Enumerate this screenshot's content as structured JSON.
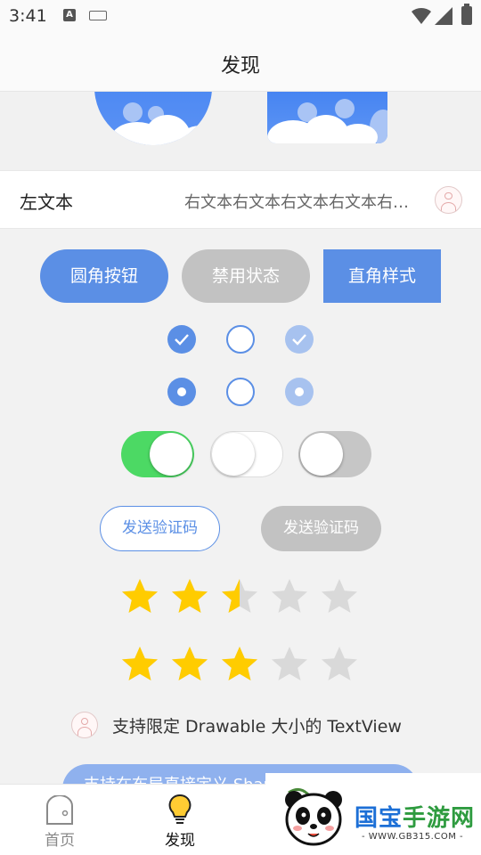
{
  "status_bar": {
    "time": "3:41",
    "notification_icon": "A",
    "icons": [
      "keyboard-icon",
      "wifi-icon",
      "signal-icon",
      "battery-icon"
    ]
  },
  "title_bar": {
    "title": "发现"
  },
  "setting_row": {
    "left_text": "左文本",
    "right_text": "右文本右文本右文本右文本右文本"
  },
  "buttons": {
    "rounded": "圆角按钮",
    "disabled": "禁用状态",
    "square": "直角样式"
  },
  "checkboxes": [
    {
      "state": "checked"
    },
    {
      "state": "unchecked"
    },
    {
      "state": "checked-disabled"
    }
  ],
  "radios": [
    {
      "state": "selected"
    },
    {
      "state": "unselected"
    },
    {
      "state": "selected-disabled"
    }
  ],
  "switches": [
    {
      "state": "on"
    },
    {
      "state": "off"
    },
    {
      "state": "disabled"
    }
  ],
  "verify_buttons": {
    "active": "发送验证码",
    "disabled": "发送验证码"
  },
  "ratings": [
    {
      "value": 2.5,
      "max": 5
    },
    {
      "value": 3,
      "max": 5
    }
  ],
  "drawable_text": "支持限定 Drawable 大小的 TextView",
  "custom_button": "支持在布局直接定义 Shape",
  "bottom_nav": {
    "items": [
      {
        "label": "首页"
      },
      {
        "label": "发现"
      }
    ]
  },
  "watermark": {
    "title_part1": "国宝",
    "title_part2": "手游网",
    "url": "- WWW.GB315.COM -"
  },
  "colors": {
    "accent": "#5b8fe5",
    "switch_on": "#4cd964",
    "star": "#ffcc00",
    "star_empty": "#d9d9d9",
    "disabled": "#c2c2c2"
  }
}
